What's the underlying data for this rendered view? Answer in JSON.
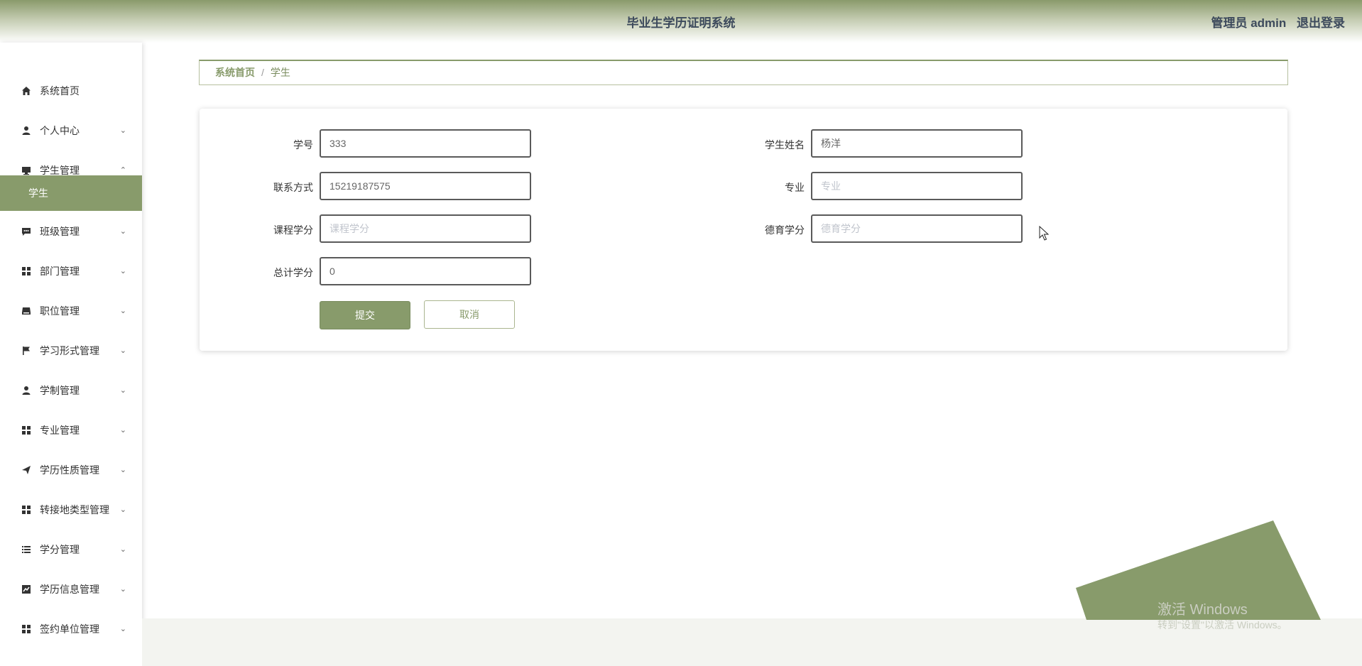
{
  "header": {
    "title": "毕业生学历证明系统",
    "admin": "管理员 admin",
    "logout": "退出登录"
  },
  "sidebar": {
    "items": [
      {
        "label": "系统首页",
        "icon": "home-icon"
      },
      {
        "label": "个人中心",
        "icon": "person-icon",
        "expanded": false
      },
      {
        "label": "学生管理",
        "icon": "monitor-icon",
        "expanded": true
      },
      {
        "label": "班级管理",
        "icon": "chat-icon",
        "expanded": false
      },
      {
        "label": "部门管理",
        "icon": "grid-icon",
        "expanded": false
      },
      {
        "label": "职位管理",
        "icon": "tray-icon",
        "expanded": false
      },
      {
        "label": "学习形式管理",
        "icon": "flag-icon",
        "expanded": false
      },
      {
        "label": "学制管理",
        "icon": "person-icon",
        "expanded": false
      },
      {
        "label": "专业管理",
        "icon": "grid-icon",
        "expanded": false
      },
      {
        "label": "学历性质管理",
        "icon": "send-icon",
        "expanded": false
      },
      {
        "label": "转接地类型管理",
        "icon": "grid-icon",
        "expanded": false
      },
      {
        "label": "学分管理",
        "icon": "list-icon",
        "expanded": false
      },
      {
        "label": "学历信息管理",
        "icon": "chart-icon",
        "expanded": false
      },
      {
        "label": "签约单位管理",
        "icon": "grid-icon",
        "expanded": false
      }
    ],
    "active_sub": "学生",
    "chevron_down": "⌄",
    "chevron_up": "⌃"
  },
  "breadcrumb": {
    "home": "系统首页",
    "separator": "/",
    "current": "学生"
  },
  "form": {
    "student_id": {
      "label": "学号",
      "value": "333",
      "placeholder": ""
    },
    "student_name": {
      "label": "学生姓名",
      "value": "杨洋",
      "placeholder": ""
    },
    "phone": {
      "label": "联系方式",
      "value": "15219187575",
      "placeholder": ""
    },
    "major": {
      "label": "专业",
      "value": "",
      "placeholder": "专业"
    },
    "course_credits": {
      "label": "课程学分",
      "value": "",
      "placeholder": "课程学分"
    },
    "moral_credits": {
      "label": "德育学分",
      "value": "",
      "placeholder": "德育学分"
    },
    "total_credits": {
      "label": "总计学分",
      "value": "0",
      "placeholder": ""
    },
    "submit": "提交",
    "cancel": "取消"
  },
  "watermark": {
    "line1": "激活 Windows",
    "line2": "转到\"设置\"以激活 Windows。"
  },
  "colors": {
    "accent": "#889b6b",
    "header_text": "#3d4a5c"
  }
}
